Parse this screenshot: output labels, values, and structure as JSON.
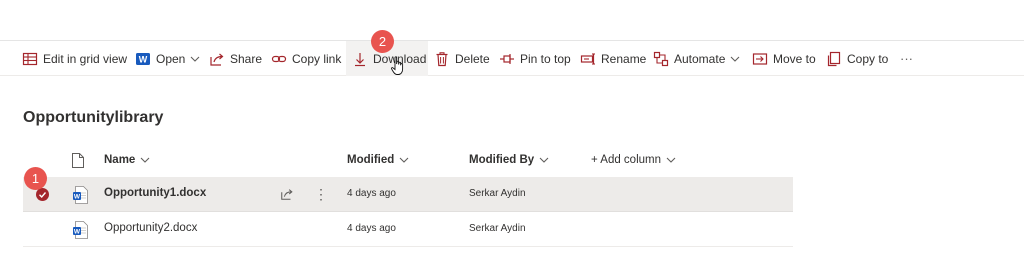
{
  "toolbar": {
    "edit_grid": "Edit in grid view",
    "open": "Open",
    "share": "Share",
    "copy_link": "Copy link",
    "download": "Download",
    "delete": "Delete",
    "pin_to_top": "Pin to top",
    "rename": "Rename",
    "automate": "Automate",
    "move_to": "Move to",
    "copy_to": "Copy to",
    "more": "···"
  },
  "library": {
    "title": "Opportunitylibrary"
  },
  "columns": {
    "name": "Name",
    "modified": "Modified",
    "modified_by": "Modified By",
    "add_column": "+ Add column"
  },
  "rows": [
    {
      "name": "Opportunity1.docx",
      "modified": "4 days ago",
      "modified_by": "Serkar Aydin",
      "selected": true
    },
    {
      "name": "Opportunity2.docx",
      "modified": "4 days ago",
      "modified_by": "Serkar Aydin",
      "selected": false
    }
  ],
  "steps": {
    "step1": "1",
    "step2": "2"
  },
  "colors": {
    "accent_red": "#a4262c",
    "badge": "#e8544f",
    "word_blue": "#185abd"
  }
}
